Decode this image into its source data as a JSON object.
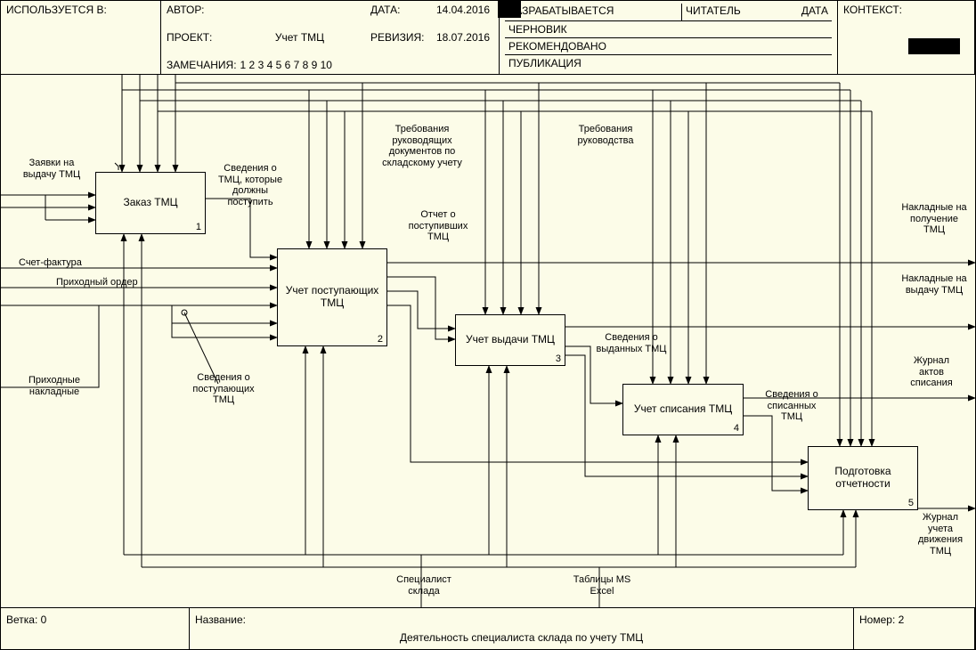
{
  "header": {
    "used_in_lbl": "ИСПОЛЬЗУЕТСЯ В:",
    "author_lbl": "АВТОР:",
    "project_lbl": "ПРОЕКТ:",
    "project": "Учет ТМЦ",
    "date_lbl": "ДАТА:",
    "date": "14.04.2016",
    "rev_lbl": "РЕВИЗИЯ:",
    "rev": "18.07.2016",
    "notes_lbl": "ЗАМЕЧАНИЯ:",
    "notes": "1 2 3 4 5 6 7 8 9 10",
    "dev": "РАЗРАБАТЫВАЕТСЯ",
    "reader": "ЧИТАТЕЛЬ",
    "date2": "ДАТА",
    "draft": "ЧЕРНОВИК",
    "recommended": "РЕКОМЕНДОВАНО",
    "publication": "ПУБЛИКАЦИЯ",
    "context": "КОНТЕКСТ:"
  },
  "nodes": {
    "n1": {
      "title": "Заказ ТМЦ",
      "num": "1"
    },
    "n2": {
      "title": "Учет поступающих ТМЦ",
      "num": "2"
    },
    "n3": {
      "title": "Учет выдачи ТМЦ",
      "num": "3"
    },
    "n4": {
      "title": "Учет списания ТМЦ",
      "num": "4"
    },
    "n5": {
      "title": "Подготовка отчетности",
      "num": "5"
    }
  },
  "labels": {
    "l_zajavki": "Заявки на выдачу ТМЦ",
    "l_schet": "Счет-фактура",
    "l_prih_order": "Приходный ордер",
    "l_prih_nakl": "Приходные накладные",
    "l_sved_tmc": "Сведения о ТМЦ, которые должны поступить",
    "l_sved_post": "Сведения о поступающих ТМЦ",
    "l_treb_doc": "Требования руководящих документов по складскому учету",
    "l_otchet_post": "Отчет о поступивших ТМЦ",
    "l_treb_ruk": "Требования руководства",
    "l_sved_vyd": "Сведения о выданных ТМЦ",
    "l_sved_spis": "Сведения о списанных ТМЦ",
    "l_nakl_pol": "Накладные на получение ТМЦ",
    "l_nakl_vyd": "Накладные на выдачу ТМЦ",
    "l_jurn_akt": "Журнал актов списания",
    "l_jurn_dvij": "Журнал учета движения ТМЦ",
    "l_spec": "Специалист склада",
    "l_excel": "Таблицы MS Excel"
  },
  "footer": {
    "branch_lbl": "Ветка:",
    "branch": "0",
    "name_lbl": "Название:",
    "name": "Деятельность специалиста склада по учету ТМЦ",
    "num_lbl": "Номер:",
    "num": "2"
  }
}
